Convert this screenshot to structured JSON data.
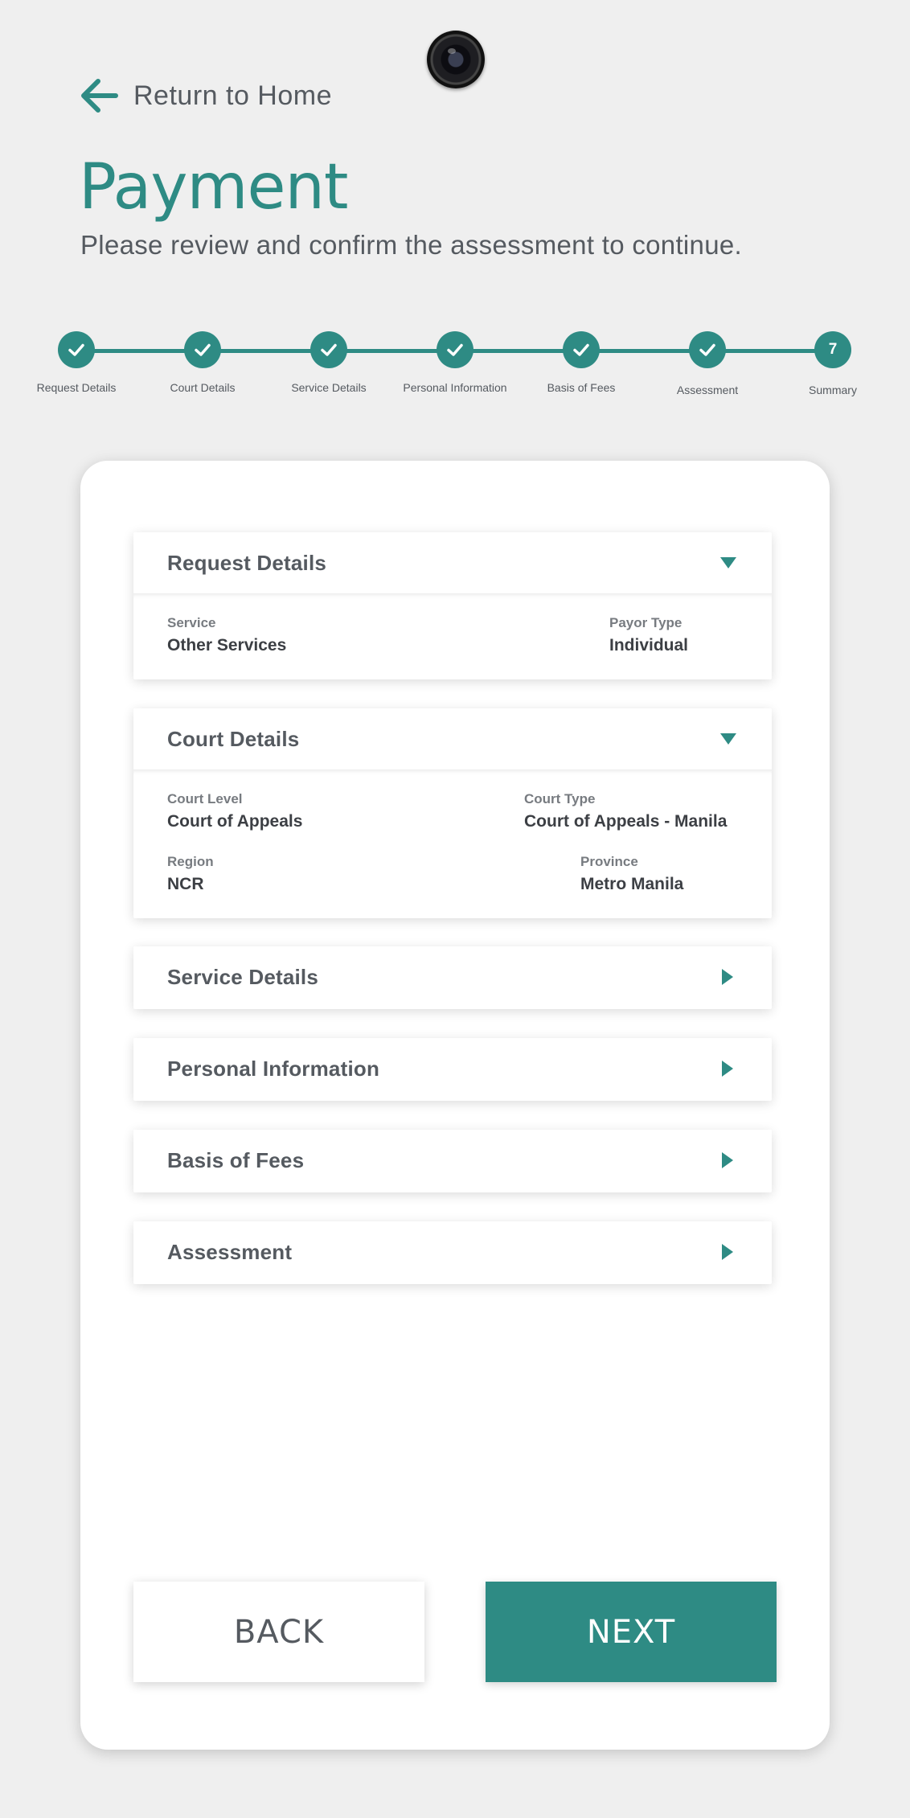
{
  "nav": {
    "return_label": "Return to Home"
  },
  "header": {
    "title": "Payment",
    "subtitle": "Please review and confirm the assessment to continue."
  },
  "stepper": {
    "steps": [
      {
        "label": "Request Details",
        "state": "complete"
      },
      {
        "label": "Court Details",
        "state": "complete"
      },
      {
        "label": "Service Details",
        "state": "complete"
      },
      {
        "label": "Personal Information",
        "state": "complete"
      },
      {
        "label": "Basis of Fees",
        "state": "complete"
      },
      {
        "label": "Assessment",
        "state": "complete"
      },
      {
        "label": "Summary",
        "state": "current",
        "number": "7"
      }
    ]
  },
  "sections": {
    "request_details": {
      "title": "Request Details",
      "expanded": true,
      "fields": [
        {
          "label": "Service",
          "value": "Other Services"
        },
        {
          "label": "Payor Type",
          "value": "Individual"
        }
      ]
    },
    "court_details": {
      "title": "Court Details",
      "expanded": true,
      "fields": [
        {
          "label": "Court Level",
          "value": "Court of Appeals"
        },
        {
          "label": "Court Type",
          "value": "Court of Appeals - Manila"
        },
        {
          "label": "Region",
          "value": "NCR"
        },
        {
          "label": "Province",
          "value": "Metro Manila"
        }
      ]
    },
    "service_details": {
      "title": "Service Details",
      "expanded": false
    },
    "personal_information": {
      "title": "Personal Information",
      "expanded": false
    },
    "basis_of_fees": {
      "title": "Basis of Fees",
      "expanded": false
    },
    "assessment": {
      "title": "Assessment",
      "expanded": false
    }
  },
  "actions": {
    "back_label": "BACK",
    "next_label": "NEXT"
  },
  "colors": {
    "accent": "#2e8b84",
    "background": "#efefef",
    "text": "#555a60"
  },
  "icons": {
    "back": "arrow-left-icon",
    "expand": "triangle-down-icon",
    "collapse": "triangle-right-icon",
    "step_done": "checkmark-icon"
  }
}
